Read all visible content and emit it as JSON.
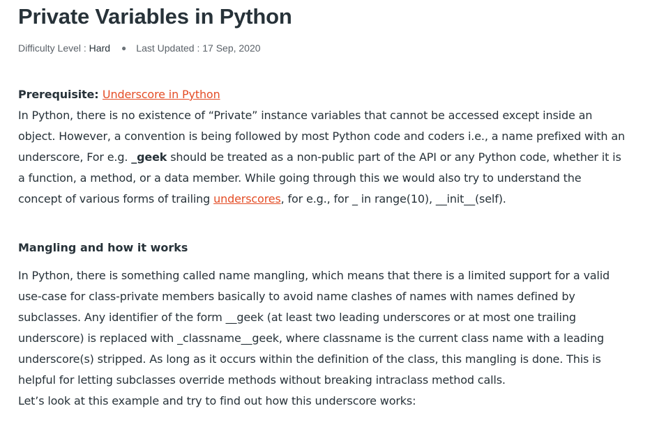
{
  "article": {
    "title": "Private Variables in Python",
    "meta": {
      "difficulty_label": "Difficulty Level : ",
      "difficulty_value": "Hard",
      "separator": "●",
      "updated": "Last Updated : 17 Sep, 2020"
    },
    "prereq": {
      "label": "Prerequisite: ",
      "link_text": "Underscore in Python"
    },
    "intro": {
      "line1": "In Python, there is no existence of “Private” instance variables that cannot be accessed except inside an",
      "line2": "object. However, a convention is being followed by most Python code and coders i.e., a name prefixed with an",
      "line3_before": "underscore, For e.g. ",
      "line3_bold": "_geek",
      "line3_after": " should be treated as a non-public part of the API or any Python code, whether it is",
      "line4": "a function, a method, or a data member. While going through this we would also try to understand the",
      "line5_before": "concept of various forms of trailing ",
      "line5_link": "underscores",
      "line5_after": ", for e.g., for _ in range(10), __init__(self)."
    },
    "section_heading": "Mangling and how it works",
    "mangling": {
      "line1": "In Python, there is something called name mangling, which means that there is a limited support for a valid",
      "line2": "use-case for class-private members basically to avoid name clashes of names with names defined by",
      "line3": "subclasses. Any identifier of the form __geek (at least two leading underscores or at most one trailing",
      "line4": "underscore) is replaced with _classname__geek, where classname is the current class name with a leading",
      "line5": "underscore(s) stripped. As long as it occurs within the definition of the class, this mangling is done. This is",
      "line6": "helpful for letting subclasses override methods without breaking intraclass method calls.",
      "line7": "Let’s look at this example and try to find out how this underscore works:"
    }
  },
  "colors": {
    "text": "#273239",
    "link": "#e44d26",
    "meta": "#5a6168"
  }
}
